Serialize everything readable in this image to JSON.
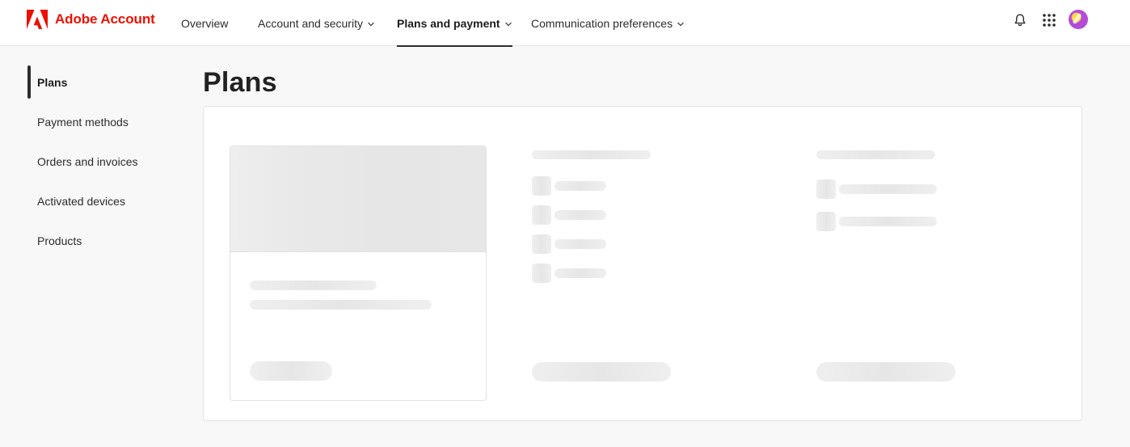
{
  "brand": {
    "name": "Adobe Account",
    "logo_icon": "adobe-logo-icon",
    "color": "#eb1000"
  },
  "nav": {
    "overview": "Overview",
    "account_security": "Account and security",
    "plans_payment": "Plans and payment",
    "communication": "Communication preferences",
    "active": "Plans and payment"
  },
  "header_icons": [
    "bell-icon",
    "app-grid-icon",
    "avatar"
  ],
  "sidebar": {
    "items": [
      {
        "label": "Plans",
        "active": true
      },
      {
        "label": "Payment methods",
        "active": false
      },
      {
        "label": "Orders and invoices",
        "active": false
      },
      {
        "label": "Activated devices",
        "active": false
      },
      {
        "label": "Products",
        "active": false
      }
    ]
  },
  "main": {
    "title": "Plans",
    "state": "loading-skeleton"
  },
  "colors": {
    "accent": "#eb1000",
    "page_bg": "#f8f8f8",
    "card_bg": "#ffffff",
    "skeleton": "#ebebeb"
  }
}
